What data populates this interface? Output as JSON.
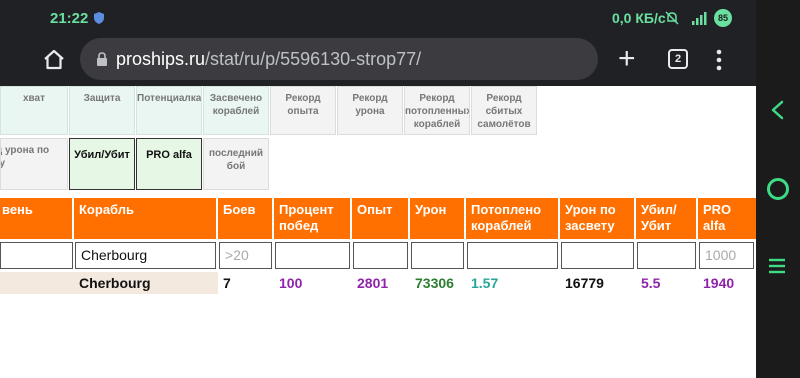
{
  "status": {
    "time": "21:22",
    "speed": "0,0 КБ/с",
    "battery": "85"
  },
  "browser": {
    "url_host": "proships.ru",
    "url_path": "/stat/ru/p/5596130-strop77/",
    "tab_count": "2"
  },
  "buttons": {
    "zahvat": "хват",
    "zashchita": "Защита",
    "potentsialka": "Потенциалка",
    "zasvecheno": "Засвечено кораблей",
    "rekord_opyta": "Рекорд опыта",
    "rekord_urona": "Рекорд урона",
    "rekord_potoplennyh": "Рекорд потопленных кораблей",
    "rekord_sbityh": "Рекорд сбитых самолётов",
    "rekord_urona_zasvetu": "Рекорд урона по засвету",
    "ubil_ubit": "Убил/Убит",
    "pro_alfa": "PRO alfa",
    "posledniy_boy": "последний бой"
  },
  "table": {
    "headers": {
      "level": "вень",
      "ship": "Корабль",
      "battles": "Боев",
      "winrate": "Процент побед",
      "exp": "Опыт",
      "damage": "Урон",
      "sunk": "Потоплено кораблей",
      "spot_damage": "Урон по засвету",
      "kd": "Убил/ Убит",
      "pro": "PRO alfa"
    },
    "filters": {
      "ship": "Cherbourg",
      "battles_placeholder": ">20",
      "pro_placeholder": "1000"
    },
    "row": {
      "ship": "Cherbourg",
      "battles": "7",
      "winrate": "100",
      "exp": "2801",
      "damage": "73306",
      "sunk": "1.57",
      "spot_damage": "16779",
      "kd": "5.5",
      "pro": "1940"
    }
  },
  "colors": {
    "header_orange": "#ff7000",
    "purple": "#8e24aa",
    "green": "#2e7d32",
    "teal": "#26a69a"
  }
}
